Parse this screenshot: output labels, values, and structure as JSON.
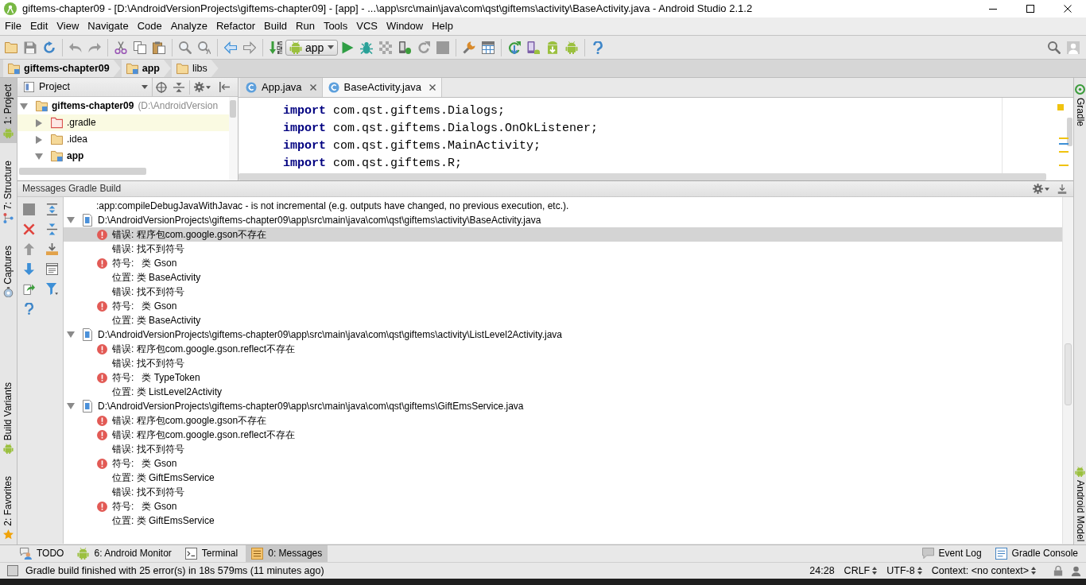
{
  "window": {
    "title": "giftems-chapter09 - [D:\\AndroidVersionProjects\\giftems-chapter09] - [app] - ...\\app\\src\\main\\java\\com\\qst\\giftems\\activity\\BaseActivity.java - Android Studio 2.1.2"
  },
  "menu": [
    "File",
    "Edit",
    "View",
    "Navigate",
    "Code",
    "Analyze",
    "Refactor",
    "Build",
    "Run",
    "Tools",
    "VCS",
    "Window",
    "Help"
  ],
  "toolbar": {
    "run_configuration": "app"
  },
  "breadcrumbs": [
    {
      "label": "giftems-chapter09",
      "kind": "module"
    },
    {
      "label": "app",
      "kind": "module"
    },
    {
      "label": "libs",
      "kind": "folder"
    }
  ],
  "left_tool_strip": {
    "top": [
      {
        "label": "1: Project",
        "selected": true
      },
      {
        "label": "7: Structure",
        "selected": false
      },
      {
        "label": "Captures",
        "selected": false
      }
    ],
    "bottom": [
      {
        "label": "Build Variants",
        "selected": false
      },
      {
        "label": "2: Favorites",
        "selected": false
      }
    ]
  },
  "project_panel": {
    "view": "Project",
    "tree": [
      {
        "label": "giftems-chapter09",
        "hint": "(D:\\AndroidVersion",
        "kind": "module",
        "expanded": true,
        "children": [
          {
            "label": ".gradle",
            "kind": "excluded",
            "expanded": false
          },
          {
            "label": ".idea",
            "kind": "folder",
            "expanded": false
          },
          {
            "label": "app",
            "kind": "module",
            "expanded": true
          }
        ]
      }
    ]
  },
  "editor": {
    "tabs": [
      {
        "label": "App.java",
        "selected": false
      },
      {
        "label": "BaseActivity.java",
        "selected": true
      }
    ],
    "lines": [
      "**import** com.qst.giftems.Dialogs;",
      "**import** com.qst.giftems.Dialogs.OnOkListener;",
      "**import** com.qst.giftems.MainActivity;",
      "**import** com.qst.giftems.R;"
    ]
  },
  "messages": {
    "title": "Messages Gradle Build",
    "info": ":app:compileDebugJavaWithJavac - is not incremental (e.g. outputs have changed, no previous execution, etc.).",
    "files": [
      {
        "path": "D:\\AndroidVersionProjects\\giftems-chapter09\\app\\src\\main\\java\\com\\qst\\giftems\\activity\\BaseActivity.java",
        "expanded": true,
        "items": [
          {
            "text": "错误: 程序包com.google.gson不存在",
            "error": true,
            "selected": true
          },
          {
            "text": "错误: 找不到符号",
            "error": false,
            "selected": false
          },
          {
            "text": "符号:   类 Gson",
            "error": true,
            "selected": false
          },
          {
            "text": "位置: 类 BaseActivity",
            "error": false,
            "selected": false
          },
          {
            "text": "错误: 找不到符号",
            "error": false,
            "selected": false
          },
          {
            "text": "符号:   类 Gson",
            "error": true,
            "selected": false
          },
          {
            "text": "位置: 类 BaseActivity",
            "error": false,
            "selected": false
          }
        ]
      },
      {
        "path": "D:\\AndroidVersionProjects\\giftems-chapter09\\app\\src\\main\\java\\com\\qst\\giftems\\activity\\ListLevel2Activity.java",
        "expanded": true,
        "items": [
          {
            "text": "错误: 程序包com.google.gson.reflect不存在",
            "error": true,
            "selected": false
          },
          {
            "text": "错误: 找不到符号",
            "error": false,
            "selected": false
          },
          {
            "text": "符号:   类 TypeToken",
            "error": true,
            "selected": false
          },
          {
            "text": "位置: 类 ListLevel2Activity",
            "error": false,
            "selected": false
          }
        ]
      },
      {
        "path": "D:\\AndroidVersionProjects\\giftems-chapter09\\app\\src\\main\\java\\com\\qst\\giftems\\GiftEmsService.java",
        "expanded": true,
        "items": [
          {
            "text": "错误: 程序包com.google.gson不存在",
            "error": true,
            "selected": false
          },
          {
            "text": "错误: 程序包com.google.gson.reflect不存在",
            "error": true,
            "selected": false
          },
          {
            "text": "错误: 找不到符号",
            "error": false,
            "selected": false
          },
          {
            "text": "符号:   类 Gson",
            "error": true,
            "selected": false
          },
          {
            "text": "位置: 类 GiftEmsService",
            "error": false,
            "selected": false
          },
          {
            "text": "错误: 找不到符号",
            "error": false,
            "selected": false
          },
          {
            "text": "符号:   类 Gson",
            "error": true,
            "selected": false
          },
          {
            "text": "位置: 类 GiftEmsService",
            "error": false,
            "selected": false
          }
        ]
      }
    ]
  },
  "right_tool_strip": [
    {
      "label": "Gradle",
      "selected": false
    },
    {
      "label": "Android Model",
      "selected": false
    }
  ],
  "bottom_tool_bar": {
    "left": [
      {
        "label": "TODO",
        "selected": false
      },
      {
        "label": "6: Android Monitor",
        "selected": false
      },
      {
        "label": "Terminal",
        "selected": false
      },
      {
        "label": "0: Messages",
        "selected": true
      }
    ],
    "right": [
      {
        "label": "Event Log",
        "selected": false
      },
      {
        "label": "Gradle Console",
        "selected": false
      }
    ]
  },
  "status_bar": {
    "message": "Gradle build finished with 25 error(s) in 18s 579ms (11 minutes ago)",
    "position": "24:28",
    "line_separator": "CRLF",
    "encoding": "UTF-8",
    "context": "Context: <no context>"
  }
}
